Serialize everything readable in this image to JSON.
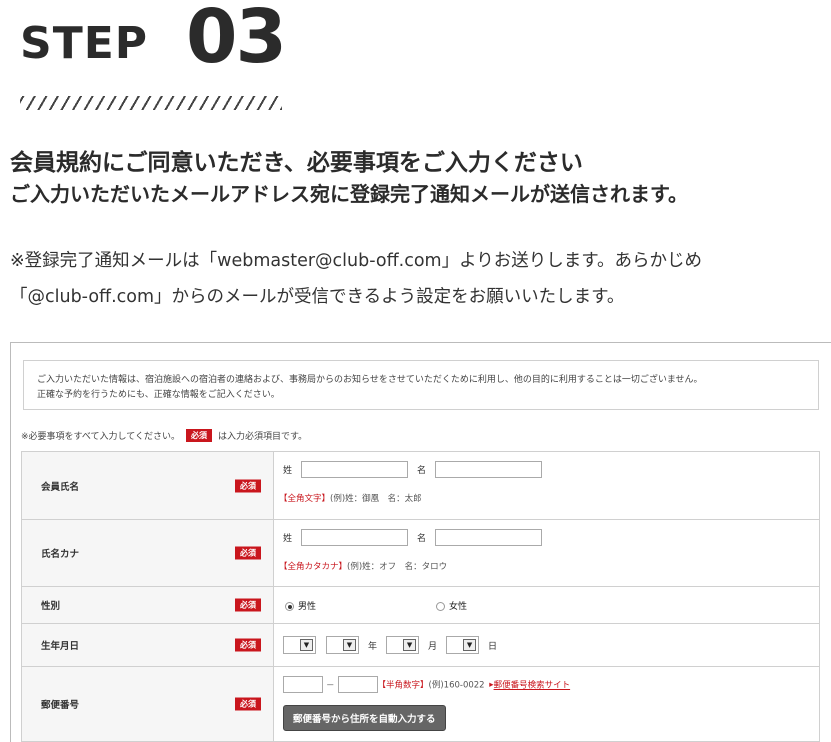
{
  "step": {
    "word": "STEP",
    "number": "03"
  },
  "headings": {
    "title": "会員規約にご同意いただき、必要事項をご入力ください",
    "subtitle": "ご入力いただいたメールアドレス宛に登録完了通知メールが送信されます。"
  },
  "notes": {
    "line1": "※登録完了通知メールは「webmaster@club-off.com」よりお送りします。あらかじめ",
    "line2": "「@club-off.com」からのメールが受信できるよう設定をお願いいたします。"
  },
  "form": {
    "info_line1": "ご入力いただいた情報は、宿泊施設への宿泊者の連絡および、事務局からのお知らせをさせていただくために利用し、他の目的に利用することは一切ございません。",
    "info_line2": "正確な予約を行うためにも、正確な情報をご記入ください。",
    "required_prefix": "※必要事項をすべて入力してください。",
    "required_badge": "必須",
    "required_suffix": "は入力必須項目です。",
    "rows": {
      "name": {
        "label": "会員氏名",
        "sei": "姓",
        "mei": "名",
        "hint_red": "【全角文字】",
        "hint": "(例)姓：御凰　名：太郎"
      },
      "kana": {
        "label": "氏名カナ",
        "sei": "姓",
        "mei": "名",
        "hint_red": "【全角カタカナ】",
        "hint": "(例)姓：オフ　名：タロウ"
      },
      "gender": {
        "label": "性別",
        "male": "男性",
        "female": "女性"
      },
      "birthday": {
        "label": "生年月日",
        "year": "年",
        "month": "月",
        "day": "日"
      },
      "postal": {
        "label": "郵便番号",
        "dash": "－",
        "hint_red": "【半角数字】",
        "hint": "(例)160-0022",
        "link_arrow": "▸",
        "link": "郵便番号検索サイト",
        "button": "郵便番号から住所を自動入力する"
      }
    }
  },
  "colors": {
    "accent_red": "#c9161d",
    "button_gray": "#666666"
  }
}
